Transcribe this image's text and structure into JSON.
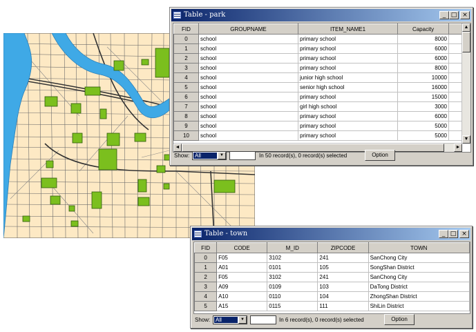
{
  "map": {
    "name": "city map"
  },
  "park_window": {
    "title": "Table - park",
    "columns": [
      "FID",
      "GROUPNAME",
      "ITEM_NAME1",
      "Capacity"
    ],
    "rows": [
      [
        "0",
        "school",
        "primary school",
        "8000"
      ],
      [
        "1",
        "school",
        "primary school",
        "6000"
      ],
      [
        "2",
        "school",
        "primary school",
        "6000"
      ],
      [
        "3",
        "school",
        "primary school",
        "8000"
      ],
      [
        "4",
        "school",
        "junior high school",
        "10000"
      ],
      [
        "5",
        "school",
        "senior high school",
        "16000"
      ],
      [
        "6",
        "school",
        "primary school",
        "15000"
      ],
      [
        "7",
        "school",
        "girl high school",
        "3000"
      ],
      [
        "8",
        "school",
        "primary school",
        "6000"
      ],
      [
        "9",
        "school",
        "primary school",
        "5000"
      ],
      [
        "10",
        "school",
        "primary school",
        "5000"
      ]
    ],
    "show_label": "Show:",
    "show_value": "All",
    "records_text": "In 50 record(s), 0 record(s) selected",
    "option_label": "Option"
  },
  "town_window": {
    "title": "Table - town",
    "columns": [
      "FID",
      "CODE",
      "M_ID",
      "ZIPCODE",
      "TOWN"
    ],
    "rows": [
      [
        "0",
        "F05",
        "3102",
        "241",
        "SanChong City"
      ],
      [
        "1",
        "A01",
        "0101",
        "105",
        "SongShan District"
      ],
      [
        "2",
        "F05",
        "3102",
        "241",
        "SanChong City"
      ],
      [
        "3",
        "A09",
        "0109",
        "103",
        "DaTong District"
      ],
      [
        "4",
        "A10",
        "0110",
        "104",
        "ZhongShan District"
      ],
      [
        "5",
        "A15",
        "0115",
        "111",
        "ShiLin District"
      ]
    ],
    "show_label": "Show:",
    "show_value": "All",
    "records_text": "In 6 record(s), 0 record(s) selected",
    "option_label": "Option"
  },
  "window_buttons": {
    "minimize": "_",
    "maximize": "□",
    "close": "×"
  },
  "scroll_glyphs": {
    "up": "▲",
    "down": "▼",
    "left": "◄",
    "right": "►"
  },
  "colors": {
    "title_active": "#0a246a",
    "map_land": "#fde9c4",
    "map_water": "#3fa9e6",
    "map_park": "#7bbf1e",
    "selection": "#0a246a"
  }
}
